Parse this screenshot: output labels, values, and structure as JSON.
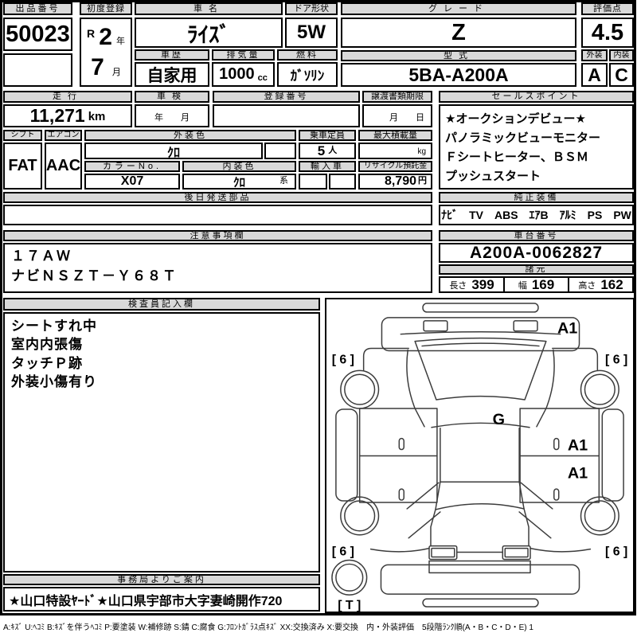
{
  "header": {
    "auction_no_label": "出品番号",
    "auction_no": "50023",
    "first_reg_label": "初度登録",
    "first_reg_era": "R",
    "first_reg_year": "2",
    "first_reg_year_unit": "年",
    "first_reg_month": "7",
    "first_reg_month_unit": "月",
    "car_name_label": "車名",
    "car_name": "ﾗｲｽﾞ",
    "door_label": "ドア形状",
    "door": "5W",
    "grade_label": "グレード",
    "grade": "Z",
    "score_label": "評価点",
    "score": "4.5",
    "history_label": "車歴",
    "history": "自家用",
    "displacement_label": "排気量",
    "displacement": "1000",
    "displacement_unit": "cc",
    "fuel_label": "燃料",
    "fuel": "ｶﾞｿﾘﾝ",
    "model_code_label": "型式",
    "model_code": "5BA-A200A",
    "exterior_label": "外装",
    "exterior_grade": "A",
    "interior_label": "内装",
    "interior_grade": "C"
  },
  "row2": {
    "mileage_label": "走行",
    "mileage": "11,271",
    "mileage_unit": "km",
    "shaken_label": "車検",
    "shaken_placeholder": "年　　月",
    "reg_no_label": "登録番号",
    "transfer_label": "譲渡書類期限",
    "transfer_placeholder": "月　　日",
    "sales_label": "セールスポイント",
    "sales_lines": [
      "★オークションデビュー★",
      "パノラミックビューモニター",
      "Ｆシートヒーター、ＢＳＭ",
      "プッシュスタート"
    ]
  },
  "row3": {
    "shift_label": "シフト",
    "shift": "FAT",
    "aircon_label": "エアコン",
    "aircon": "AAC",
    "ext_color_label": "外装色",
    "ext_color": "ｸﾛ",
    "capacity_label": "乗車定員",
    "capacity": "5",
    "capacity_unit": "人",
    "payload_label": "最大積載量",
    "payload_unit": "kg",
    "color_no_label": "カラーNo.",
    "color_no": "X07",
    "int_color_label": "内装色",
    "int_color": "ｸﾛ",
    "int_color_suffix": "系",
    "import_label": "輸入車",
    "recycle_label": "リサイクル預託金",
    "recycle": "8,790",
    "recycle_unit": "円"
  },
  "row4": {
    "late_parts_label": "後日発送部品",
    "equipment_label": "純正装備",
    "equipment": "ﾅﾋﾞ　TV　ABS　ｴｱB　ｱﾙﾐ　PS　PW"
  },
  "row5": {
    "notes_label": "注意事項欄",
    "notes_lines": [
      "１７ＡＷ",
      "ナビＮＳＺＴ－Ｙ６８Ｔ"
    ],
    "chassis_label": "車台番号",
    "chassis_no": "A200A-0062827",
    "specs_label": "諸元",
    "length_label": "長さ",
    "length": "399",
    "width_label": "幅",
    "width": "169",
    "height_label": "高さ",
    "height": "162"
  },
  "inspector": {
    "label": "検査員記入欄",
    "lines": [
      "シートすれ中",
      "室内内張傷",
      "タッチＰ跡",
      "外装小傷有り"
    ]
  },
  "office": {
    "label": "事務局よりご案内",
    "notice": "★山口特設ﾔｰﾄﾞ★山口県宇部市大字妻崎開作720"
  },
  "diagram": {
    "hood_mark": "A1",
    "windshield_mark": "G",
    "front_right_door_mark": "A1",
    "rear_right_door_mark": "A1",
    "front_left_tire_mark": "[ 6 ]",
    "front_right_tire_mark": "[ 6 ]",
    "rear_left_tire_mark": "[ 6 ]",
    "rear_right_tire_mark": "[ 6 ]",
    "spare_tire_mark": "[ T ]"
  },
  "legend": "A:ｷｽﾞ U:ﾍｺﾐ B:ｷｽﾞを伴うﾍｺﾐ P:要塗装 W:補修跡 S:錆 C:腐食 G:ﾌﾛﾝﾄｶﾞﾗｽ点ｷｽﾞ XX:交換済み X:要交換　内・外装評価　5段階ﾗﾝｸ順(A・B・C・D・E) 1"
}
